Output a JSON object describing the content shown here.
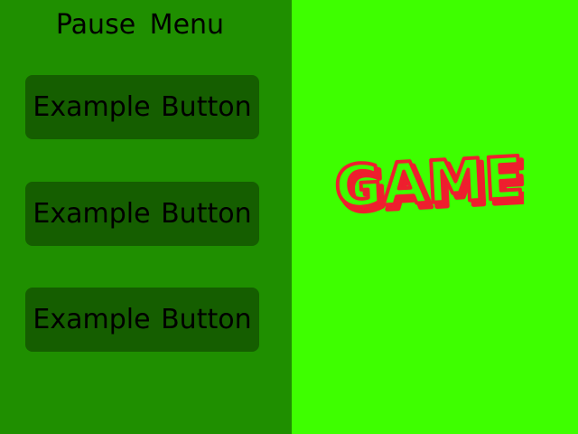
{
  "pause_menu": {
    "title": "Pause Menu",
    "buttons": [
      {
        "label": "Example Button"
      },
      {
        "label": "Example Button"
      },
      {
        "label": "Example Button"
      }
    ]
  },
  "game_area": {
    "logo_text": "GAME"
  },
  "colors": {
    "panel_background": "#1F8F00",
    "button_background": "#155E00",
    "game_background": "#3EFF00",
    "logo_outline": "#EE1F2E",
    "logo_fill": "#3EFF00",
    "text": "#000000"
  }
}
